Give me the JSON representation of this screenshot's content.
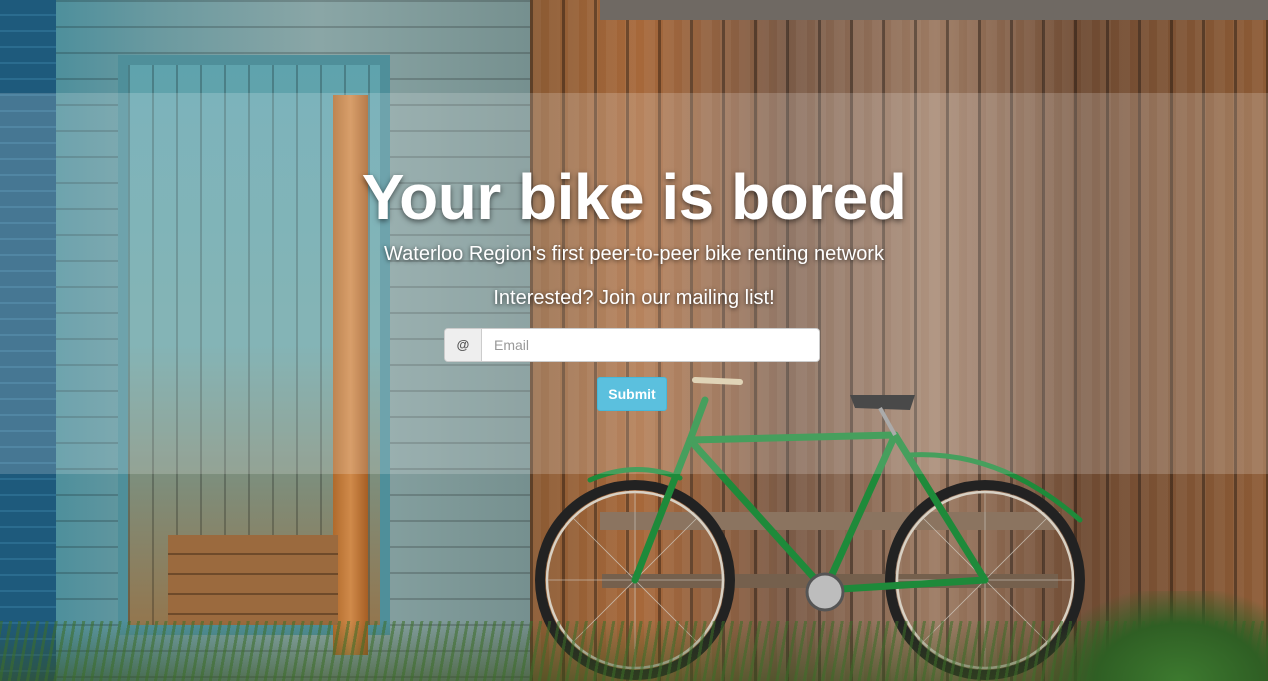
{
  "hero": {
    "title": "Your bike is bored",
    "subtitle": "Waterloo Region's first peer-to-peer bike renting network",
    "cta": "Interested? Join our mailing list!"
  },
  "form": {
    "addon": "@",
    "email_placeholder": "Email",
    "email_value": "",
    "submit_label": "Submit"
  },
  "colors": {
    "submit": "#5bc0de",
    "text": "#ffffff",
    "bike_frame": "#1e8a3a"
  },
  "background": {
    "icon": "barn-wall-with-green-bicycle"
  }
}
